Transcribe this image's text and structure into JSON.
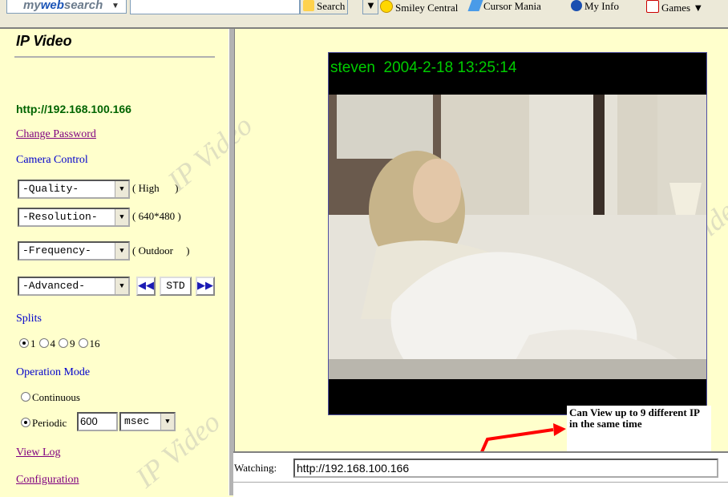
{
  "toolbar": {
    "brand_prefix": "my",
    "brand_web": "web",
    "brand_suffix": "search",
    "search_label": "Search",
    "items": [
      "Smiley Central",
      "Cursor Mania",
      "My Info",
      "Games"
    ]
  },
  "panel": {
    "title": "IP Video",
    "url": "http://192.168.100.166",
    "change_password": "Change Password",
    "camera_control": "Camera Control",
    "quality_select": "-Quality-",
    "quality_value": "( High      )",
    "resolution_select": "-Resolution-",
    "resolution_value": "( 640*480 )",
    "frequency_select": "-Frequency-",
    "frequency_value": "( Outdoor     )",
    "advanced_select": "-Advanced-",
    "std_label": "STD",
    "splits_label": "Splits",
    "splits_options": [
      "1",
      "4",
      "9",
      "16"
    ],
    "operation_mode": "Operation Mode",
    "continuous": "Continuous",
    "periodic": "Periodic",
    "periodic_value": "600",
    "unit_select": "msec",
    "view_log": "View Log",
    "configuration": "Configuration",
    "watermark": "IP Video"
  },
  "video": {
    "overlay": "steven  2004-2-18 13:25:14"
  },
  "annotation": {
    "text": "Can View up to 9 different IP in the same time"
  },
  "bottom": {
    "watching_label": "Watching:",
    "watching_url": "http://192.168.100.166"
  },
  "colors": {
    "page_bg": "#ffffcc",
    "overlay_text": "#00cc00",
    "arrow": "#ff0000"
  }
}
